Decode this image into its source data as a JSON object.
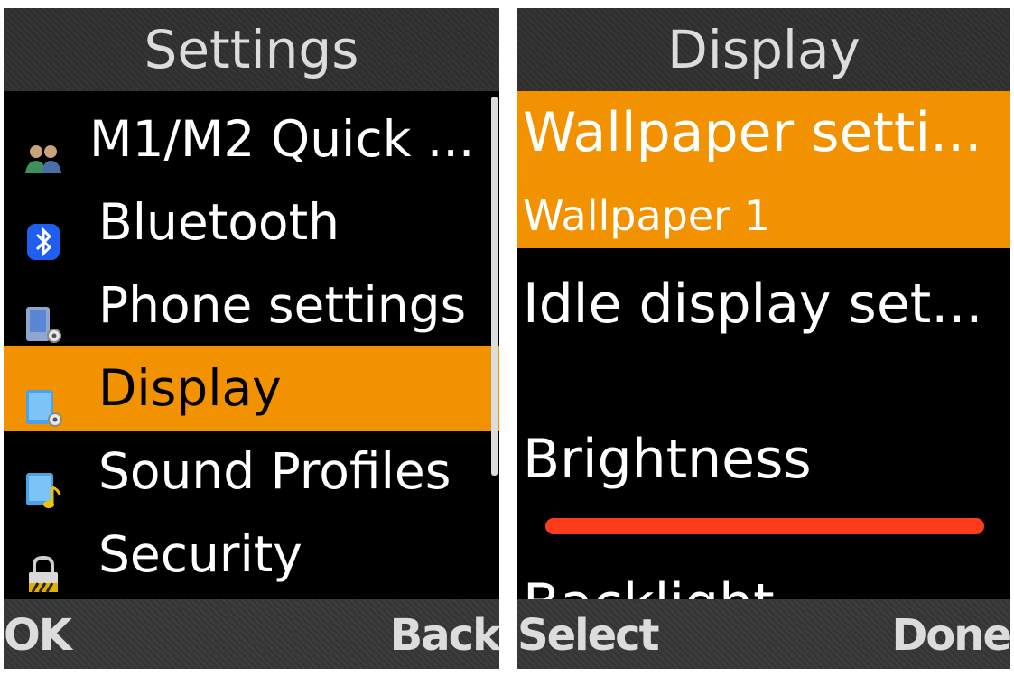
{
  "left": {
    "title": "Settings",
    "items": [
      {
        "label": "M1/M2 Quick ...",
        "icon": "users-icon",
        "selected": false
      },
      {
        "label": "Bluetooth",
        "icon": "bluetooth-icon",
        "selected": false
      },
      {
        "label": "Phone settings",
        "icon": "phone-settings-icon",
        "selected": false
      },
      {
        "label": "Display",
        "icon": "display-settings-icon",
        "selected": true
      },
      {
        "label": "Sound Profiles",
        "icon": "sound-profiles-icon",
        "selected": false
      },
      {
        "label": "Security",
        "icon": "padlock-icon",
        "selected": false
      }
    ],
    "softkey_left": "OK",
    "softkey_right": "Back"
  },
  "right": {
    "title": "Display",
    "wallpaper_label": "Wallpaper setti...",
    "wallpaper_value": "Wallpaper 1",
    "idle_label": "Idle display set...",
    "brightness_label": "Brightness",
    "brightness_level": 1.0,
    "backlight_label": "Backlight",
    "softkey_left": "Select",
    "softkey_right": "Done"
  },
  "colors": {
    "highlight": "#f39200",
    "brightness_bar": "#ff3b1a",
    "titlebar": "#2f2f2f",
    "background": "#000000"
  }
}
